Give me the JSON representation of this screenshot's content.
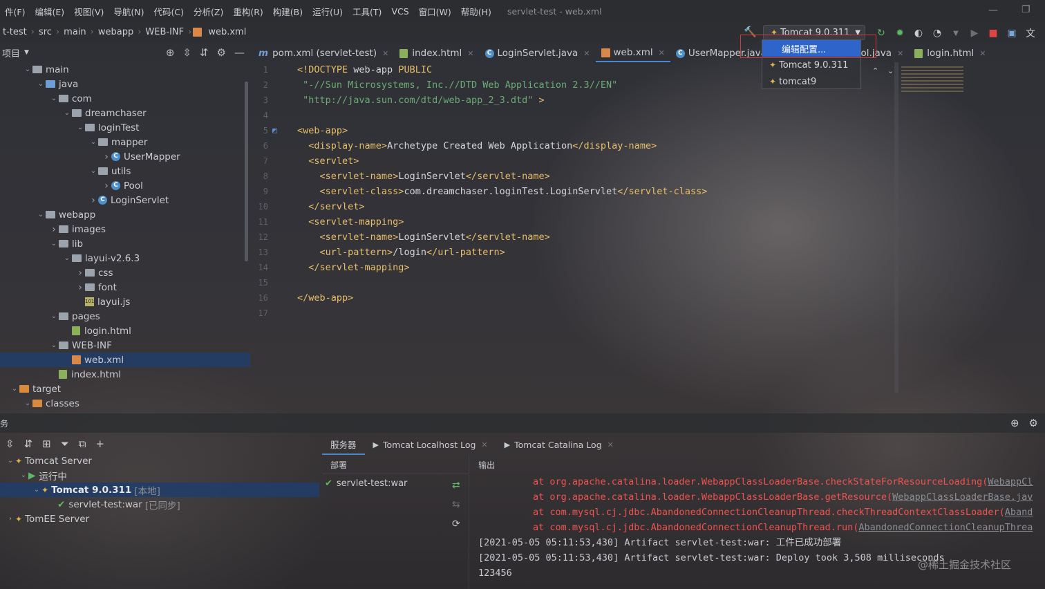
{
  "menu": [
    "件(F)",
    "编辑(E)",
    "视图(V)",
    "导航(N)",
    "代码(C)",
    "分析(Z)",
    "重构(R)",
    "构建(B)",
    "运行(U)",
    "工具(T)",
    "VCS",
    "窗口(W)",
    "帮助(H)"
  ],
  "window_title": "servlet-test - web.xml",
  "breadcrumb": [
    "t-test",
    "src",
    "main",
    "webapp",
    "WEB-INF",
    "web.xml"
  ],
  "run_config": {
    "label": "Tomcat 9.0.311",
    "options": [
      {
        "label": "编辑配置..."
      },
      {
        "label": "Tomcat 9.0.311"
      },
      {
        "label": "tomcat9"
      }
    ]
  },
  "project_panel": {
    "title": "项目"
  },
  "tree": [
    {
      "label": "main",
      "indent": 1,
      "icon": "folder",
      "open": true
    },
    {
      "label": "java",
      "indent": 2,
      "icon": "folder-blue",
      "open": true
    },
    {
      "label": "com",
      "indent": 3,
      "icon": "folder",
      "open": true
    },
    {
      "label": "dreamchaser",
      "indent": 4,
      "icon": "folder",
      "open": true
    },
    {
      "label": "loginTest",
      "indent": 5,
      "icon": "folder",
      "open": true
    },
    {
      "label": "mapper",
      "indent": 6,
      "icon": "folder",
      "open": true
    },
    {
      "label": "UserMapper",
      "indent": 7,
      "icon": "class",
      "open": false
    },
    {
      "label": "utils",
      "indent": 6,
      "icon": "folder",
      "open": true
    },
    {
      "label": "Pool",
      "indent": 7,
      "icon": "class",
      "open": false
    },
    {
      "label": "LoginServlet",
      "indent": 6,
      "icon": "class",
      "open": false
    },
    {
      "label": "webapp",
      "indent": 2,
      "icon": "folder",
      "open": true
    },
    {
      "label": "images",
      "indent": 3,
      "icon": "folder",
      "open": false
    },
    {
      "label": "lib",
      "indent": 3,
      "icon": "folder",
      "open": true
    },
    {
      "label": "layui-v2.6.3",
      "indent": 4,
      "icon": "folder",
      "open": true
    },
    {
      "label": "css",
      "indent": 5,
      "icon": "folder",
      "open": false
    },
    {
      "label": "font",
      "indent": 5,
      "icon": "folder",
      "open": false
    },
    {
      "label": "layui.js",
      "indent": 5,
      "icon": "js",
      "open": null
    },
    {
      "label": "pages",
      "indent": 3,
      "icon": "folder",
      "open": true
    },
    {
      "label": "login.html",
      "indent": 4,
      "icon": "html",
      "open": null
    },
    {
      "label": "WEB-INF",
      "indent": 3,
      "icon": "folder",
      "open": true
    },
    {
      "label": "web.xml",
      "indent": 4,
      "icon": "xml",
      "open": null,
      "selected": true
    },
    {
      "label": "index.html",
      "indent": 3,
      "icon": "html",
      "open": null
    },
    {
      "label": "target",
      "indent": 0,
      "icon": "folder-orange",
      "open": true
    },
    {
      "label": "classes",
      "indent": 1,
      "icon": "folder-orange",
      "open": true
    }
  ],
  "tabs": [
    {
      "label": "pom.xml (servlet-test)",
      "icon": "m"
    },
    {
      "label": "index.html",
      "icon": "html"
    },
    {
      "label": "LoginServlet.java",
      "icon": "c"
    },
    {
      "label": "web.xml",
      "icon": "xml",
      "active": true
    },
    {
      "label": "UserMapper.java",
      "icon": "c"
    },
    {
      "label": "va",
      "icon": "c"
    },
    {
      "label": "Pool.java",
      "icon": "c"
    },
    {
      "label": "login.html",
      "icon": "html"
    }
  ],
  "code": [
    [
      [
        "tg",
        "<!DOCTYPE "
      ],
      [
        "tx",
        "web-app "
      ],
      [
        "tg",
        "PUBLIC"
      ]
    ],
    [
      [
        "st",
        " \"-//Sun Microsystems, Inc.//DTD Web Application 2.3//EN\""
      ]
    ],
    [
      [
        "st",
        " \"http://java.sun.com/dtd/web-app_2_3.dtd\""
      ],
      [
        "tg",
        " >"
      ]
    ],
    [],
    [
      [
        "tg",
        "<web-app>"
      ]
    ],
    [
      [
        "tx",
        "  "
      ],
      [
        "tg",
        "<display-name>"
      ],
      [
        "tx",
        "Archetype Created Web Application"
      ],
      [
        "tg",
        "</display-name>"
      ]
    ],
    [
      [
        "tx",
        "  "
      ],
      [
        "tg",
        "<servlet>"
      ]
    ],
    [
      [
        "tx",
        "    "
      ],
      [
        "tg",
        "<servlet-name>"
      ],
      [
        "tx",
        "LoginServlet"
      ],
      [
        "tg",
        "</servlet-name>"
      ]
    ],
    [
      [
        "tx",
        "    "
      ],
      [
        "tg",
        "<servlet-class>"
      ],
      [
        "tx",
        "com.dreamchaser.loginTest.LoginServlet"
      ],
      [
        "tg",
        "</servlet-class>"
      ]
    ],
    [
      [
        "tx",
        "  "
      ],
      [
        "tg",
        "</servlet>"
      ]
    ],
    [
      [
        "tx",
        "  "
      ],
      [
        "tg",
        "<servlet-mapping>"
      ]
    ],
    [
      [
        "tx",
        "    "
      ],
      [
        "tg",
        "<servlet-name>"
      ],
      [
        "tx",
        "LoginServlet"
      ],
      [
        "tg",
        "</servlet-name>"
      ]
    ],
    [
      [
        "tx",
        "    "
      ],
      [
        "tg",
        "<url-pattern>"
      ],
      [
        "tx",
        "/login"
      ],
      [
        "tg",
        "</url-pattern>"
      ]
    ],
    [
      [
        "tx",
        "  "
      ],
      [
        "tg",
        "</servlet-mapping>"
      ]
    ],
    [],
    [
      [
        "tg",
        "</web-app>"
      ]
    ],
    []
  ],
  "line_numbers": [
    "1",
    "2",
    "3",
    "4",
    "5",
    "6",
    "7",
    "8",
    "9",
    "10",
    "11",
    "12",
    "13",
    "14",
    "15",
    "16",
    "17"
  ],
  "services": {
    "panel_label": "务",
    "tree": [
      {
        "label": "Tomcat Server",
        "indent": 1,
        "suffix": ""
      },
      {
        "label": "运行中",
        "indent": 2,
        "suffix": ""
      },
      {
        "label": "Tomcat 9.0.311",
        "indent": 3,
        "suffix": "[本地]",
        "selected": true,
        "bold": true
      },
      {
        "label": "servlet-test:war",
        "indent": 4,
        "suffix": "[已同步]"
      },
      {
        "label": "TomEE Server",
        "indent": 1,
        "suffix": ""
      }
    ],
    "tabs": [
      {
        "label": "服务器",
        "active": true
      },
      {
        "label": "Tomcat Localhost Log"
      },
      {
        "label": "Tomcat Catalina Log"
      }
    ],
    "deploy_header": "部署",
    "deploy_item": "servlet-test:war",
    "output_header": "输出",
    "output": [
      {
        "type": "err",
        "text": "at org.apache.catalina.loader.WebappClassLoaderBase.checkStateForResourceLoading(",
        "link": "WebappCl"
      },
      {
        "type": "err",
        "text": "at org.apache.catalina.loader.WebappClassLoaderBase.getResource(",
        "link": "WebappClassLoaderBase.jav"
      },
      {
        "type": "err",
        "text": "at com.mysql.cj.jdbc.AbandonedConnectionCleanupThread.checkThreadContextClassLoader(",
        "link": "Aband"
      },
      {
        "type": "err",
        "text": "at com.mysql.cj.jdbc.AbandonedConnectionCleanupThread.run(",
        "link": "AbandonedConnectionCleanupThrea"
      },
      {
        "type": "info",
        "text": "[2021-05-05 05:11:53,430] Artifact servlet-test:war: 工件已成功部署",
        "link": ""
      },
      {
        "type": "info",
        "text": "[2021-05-05 05:11:53,430] Artifact servlet-test:war: Deploy took 3,508 milliseconds",
        "link": ""
      },
      {
        "type": "info",
        "text": "123456",
        "link": ""
      }
    ]
  },
  "watermark": "@稀土掘金技术社区",
  "colors": {
    "accent": "#2f65ca",
    "tag": "#e8bf6a",
    "string": "#6aab73",
    "error": "#f0524f"
  }
}
